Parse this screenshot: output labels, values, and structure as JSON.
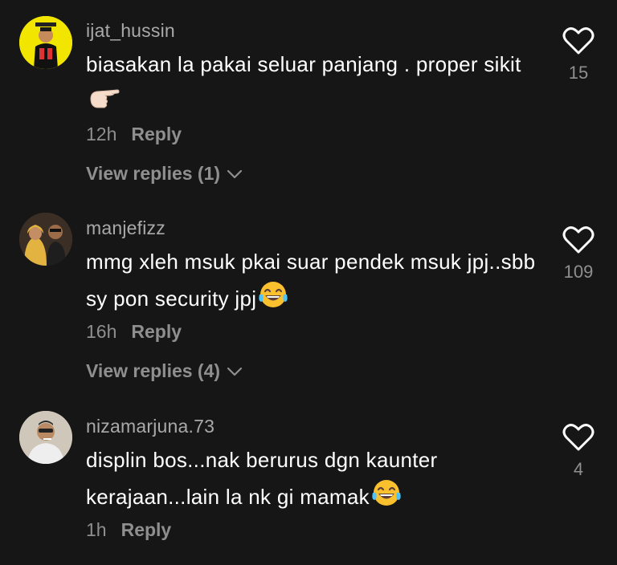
{
  "comments": [
    {
      "username": "ijat_hussin",
      "text": "biasakan la pakai seluar panjang . proper sikit",
      "emoji": "hand-pointing-right-emoji",
      "time": "12h",
      "reply_label": "Reply",
      "likes": "15",
      "view_replies": "View replies (1)"
    },
    {
      "username": "manjefizz",
      "text": "mmg xleh msuk pkai suar pendek msuk jpj..sbb sy pon security jpj",
      "emoji": "laughing-tears-emoji",
      "time": "16h",
      "reply_label": "Reply",
      "likes": "109",
      "view_replies": "View replies (4)"
    },
    {
      "username": "nizamarjuna.73",
      "text": "displin bos...nak berurus dgn kaunter kerajaan...lain la nk gi mamak",
      "emoji": "laughing-tears-emoji",
      "time": "1h",
      "reply_label": "Reply",
      "likes": "4"
    }
  ],
  "colors": {
    "background": "#161616",
    "text": "#ffffff",
    "secondary": "#8f8f8f",
    "username": "#a9a9a9",
    "avatar1_bg": "#f2e600"
  }
}
